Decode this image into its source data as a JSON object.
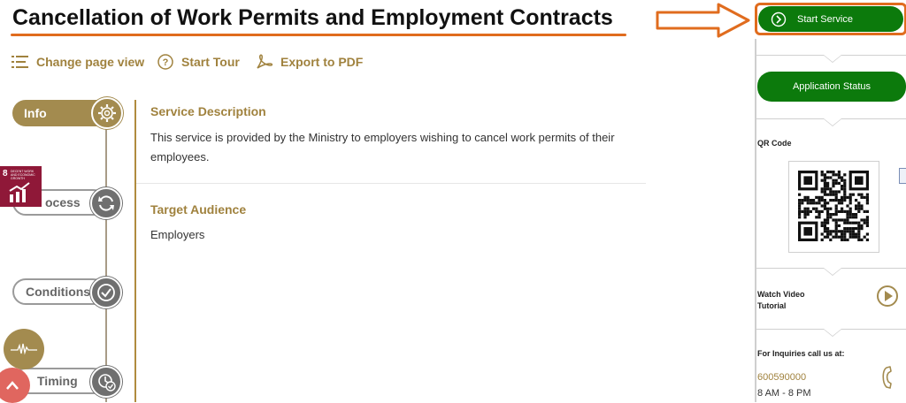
{
  "title": "Cancellation of Work Permits and Employment Contracts",
  "toolbar": {
    "change_view": "Change page view",
    "start_tour": "Start Tour",
    "export_pdf": "Export to PDF"
  },
  "timeline": {
    "items": [
      {
        "label": "Info",
        "active": true,
        "icon": "gear-icon"
      },
      {
        "label": "ocess",
        "active": false,
        "icon": "refresh-icon"
      },
      {
        "label": "Conditions",
        "active": false,
        "icon": "check-circle-icon"
      },
      {
        "label": "Timing",
        "active": false,
        "icon": "clock-check-icon"
      }
    ]
  },
  "sdg_badge": {
    "number": "8",
    "text": "DECENT WORK AND ECONOMIC GROWTH"
  },
  "main": {
    "service_description_heading": "Service Description",
    "service_description_text": "This service is provided by the Ministry to employers wishing to cancel work permits of their employees.",
    "target_audience_heading": "Target Audience",
    "target_audience_text": "Employers"
  },
  "side_panel": {
    "start_service": "Start Service",
    "application_status": "Application Status",
    "qr_code_label": "QR Code",
    "watch_video": "Watch Video Tutorial",
    "inquiries_label": "For Inquiries call us at:",
    "phone": "600590000",
    "hours": "8 AM - 8 PM"
  },
  "colors": {
    "gold": "#a38b4f",
    "green": "#0c7a0c",
    "orange_highlight": "#e06c1e",
    "sdg_red": "#8f1838"
  }
}
